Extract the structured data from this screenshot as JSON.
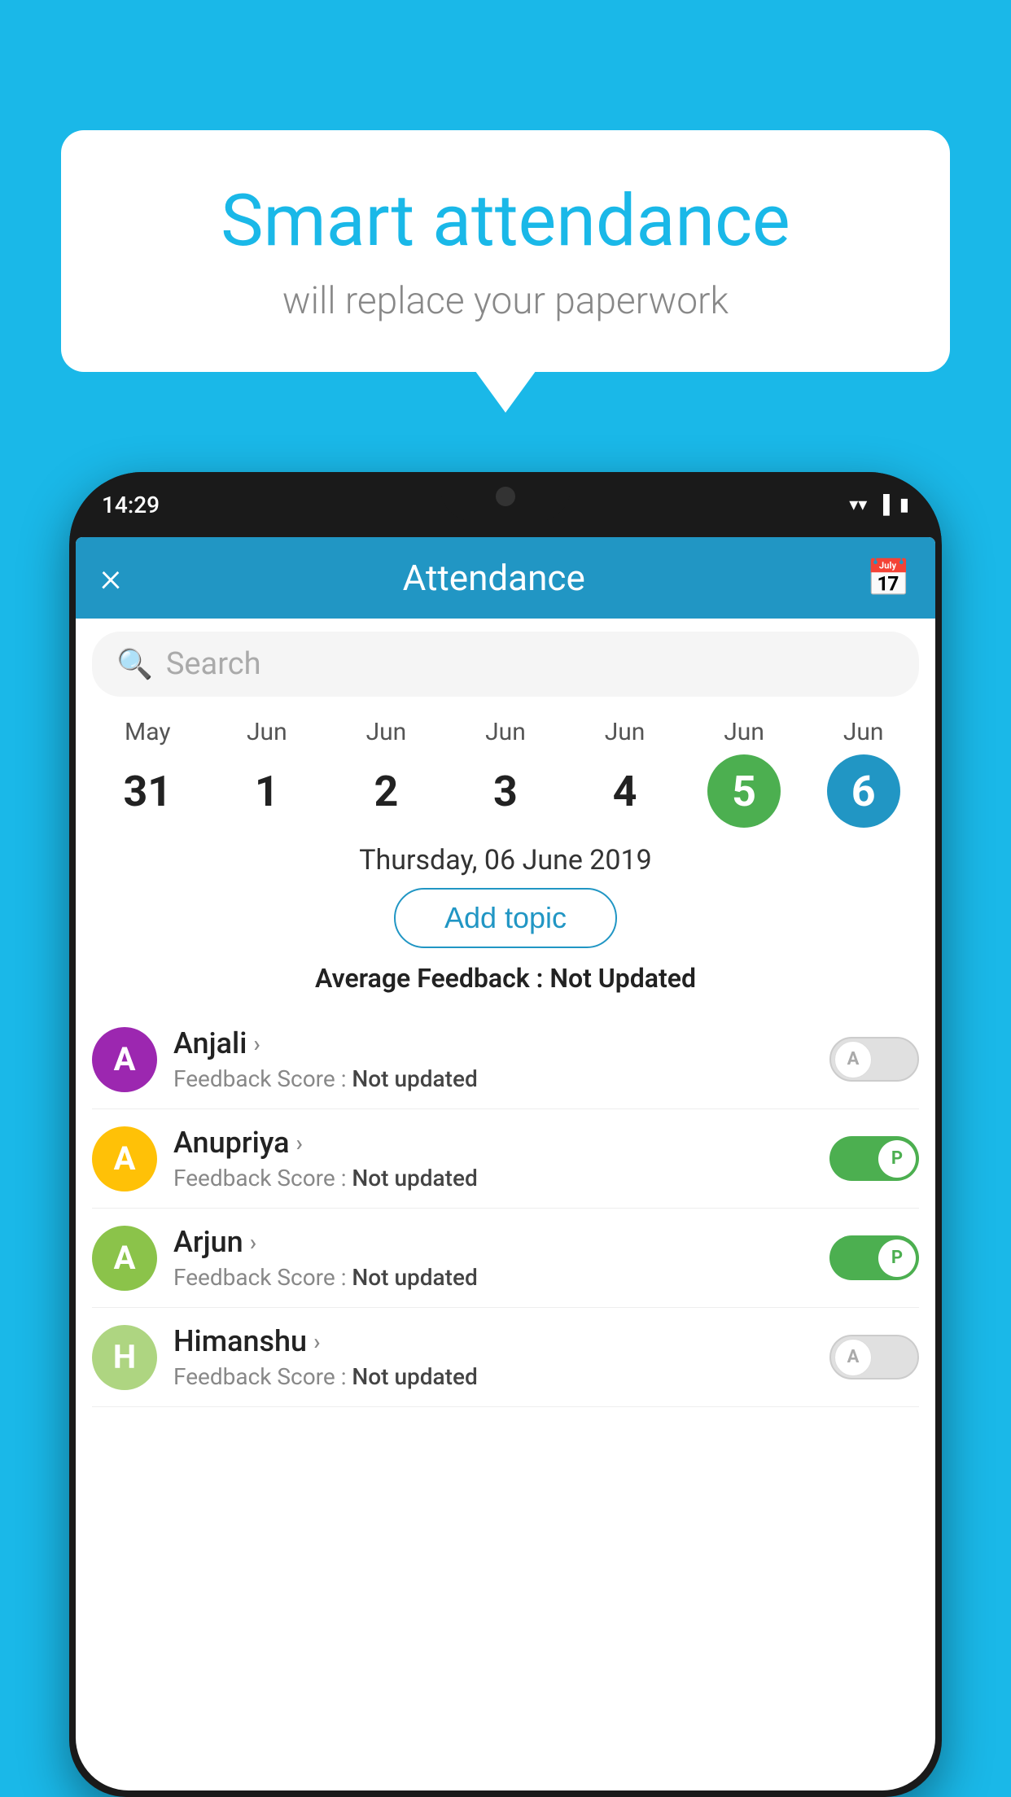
{
  "background_color": "#1ab8e8",
  "speech_bubble": {
    "title": "Smart attendance",
    "subtitle": "will replace your paperwork"
  },
  "status_bar": {
    "time": "14:29",
    "icons": [
      "wifi",
      "signal",
      "battery"
    ]
  },
  "app_header": {
    "title": "Attendance",
    "close_label": "×",
    "calendar_icon": "📅"
  },
  "search": {
    "placeholder": "Search"
  },
  "calendar": {
    "days": [
      {
        "month": "May",
        "date": "31",
        "style": "normal"
      },
      {
        "month": "Jun",
        "date": "1",
        "style": "normal"
      },
      {
        "month": "Jun",
        "date": "2",
        "style": "normal"
      },
      {
        "month": "Jun",
        "date": "3",
        "style": "normal"
      },
      {
        "month": "Jun",
        "date": "4",
        "style": "normal"
      },
      {
        "month": "Jun",
        "date": "5",
        "style": "today"
      },
      {
        "month": "Jun",
        "date": "6",
        "style": "selected"
      }
    ]
  },
  "selected_date": "Thursday, 06 June 2019",
  "add_topic_label": "Add topic",
  "average_feedback": {
    "label": "Average Feedback : ",
    "value": "Not Updated"
  },
  "students": [
    {
      "name": "Anjali",
      "avatar_letter": "A",
      "avatar_color": "#9c27b0",
      "feedback_label": "Feedback Score : ",
      "feedback_value": "Not updated",
      "toggle": "off",
      "toggle_label": "A"
    },
    {
      "name": "Anupriya",
      "avatar_letter": "A",
      "avatar_color": "#ffc107",
      "feedback_label": "Feedback Score : ",
      "feedback_value": "Not updated",
      "toggle": "on",
      "toggle_label": "P"
    },
    {
      "name": "Arjun",
      "avatar_letter": "A",
      "avatar_color": "#8bc34a",
      "feedback_label": "Feedback Score : ",
      "feedback_value": "Not updated",
      "toggle": "on",
      "toggle_label": "P"
    },
    {
      "name": "Himanshu",
      "avatar_letter": "H",
      "avatar_color": "#aed581",
      "feedback_label": "Feedback Score : ",
      "feedback_value": "Not updated",
      "toggle": "off",
      "toggle_label": "A"
    }
  ]
}
